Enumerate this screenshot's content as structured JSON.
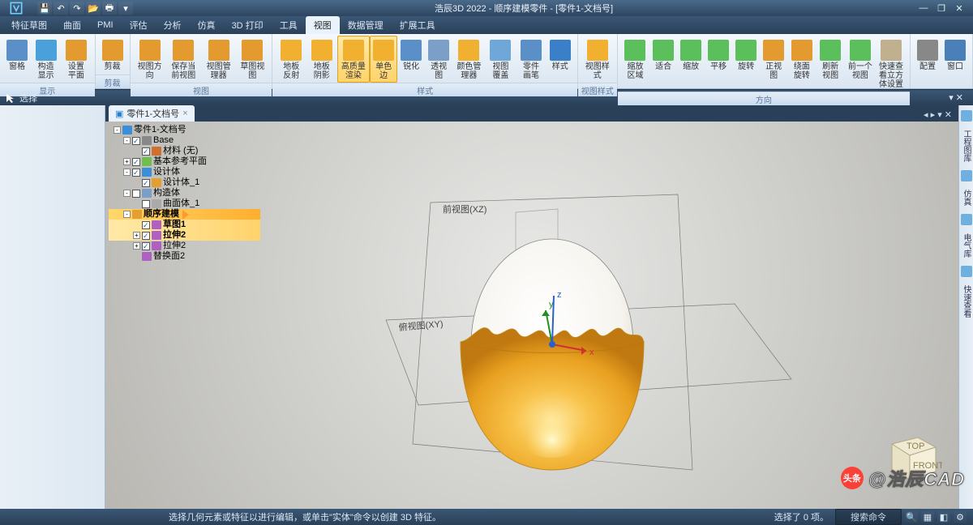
{
  "title": "浩辰3D 2022 - 顺序建模零件 - [零件1-文档号]",
  "qat_icons": [
    "save",
    "undo",
    "redo",
    "open",
    "print",
    "cut",
    "copy",
    "more"
  ],
  "menus": [
    "特征草图",
    "曲面",
    "PMI",
    "评估",
    "分析",
    "仿真",
    "3D 打印",
    "工具",
    "视图",
    "数据管理",
    "扩展工具"
  ],
  "active_menu": 8,
  "ribbon": {
    "groups": [
      {
        "label": "显示",
        "buttons": [
          {
            "label": "窗格",
            "icon": "#5b8fc7",
            "active": false
          },
          {
            "label": "构造显示",
            "icon": "#4aa0d8",
            "active": false
          },
          {
            "label": "设置平面",
            "icon": "#e39a2e",
            "active": false
          }
        ]
      },
      {
        "label": "剪裁",
        "buttons": [
          {
            "label": "剪裁",
            "icon": "#e39a2e",
            "active": false
          }
        ]
      },
      {
        "label": "视图",
        "buttons": [
          {
            "label": "视图方向",
            "icon": "#e39a2e",
            "active": false
          },
          {
            "label": "保存当前视图",
            "icon": "#e39a2e",
            "active": false
          },
          {
            "label": "视图管理器",
            "icon": "#e39a2e",
            "active": false
          },
          {
            "label": "草图视图",
            "icon": "#e39a2e",
            "active": false
          }
        ]
      },
      {
        "label": "样式",
        "buttons": [
          {
            "label": "地板反射",
            "icon": "#f2b030",
            "active": false
          },
          {
            "label": "地板阴影",
            "icon": "#f2b030",
            "active": false
          },
          {
            "label": "高质量渲染",
            "icon": "#f2b030",
            "active": true
          },
          {
            "label": "单色边",
            "icon": "#f2b030",
            "active": true
          },
          {
            "label": "锐化",
            "icon": "#5b8fc7",
            "active": false
          },
          {
            "label": "透视图",
            "icon": "#7b9fc7",
            "active": false
          },
          {
            "label": "颜色管理器",
            "icon": "#f2b030",
            "active": false
          },
          {
            "label": "视图覆盖",
            "icon": "#6fa8d8",
            "active": false
          },
          {
            "label": "零件画笔",
            "icon": "#5b8fc7",
            "active": false
          },
          {
            "label": "样式",
            "icon": "#3a7fc7",
            "active": false
          }
        ]
      },
      {
        "label": "视图样式",
        "buttons": [
          {
            "label": "视图样式",
            "icon": "#f2b030",
            "active": false
          }
        ]
      },
      {
        "label": "方向",
        "buttons": [
          {
            "label": "缩放区域",
            "icon": "#5bbf5b",
            "active": false
          },
          {
            "label": "适合",
            "icon": "#5bbf5b",
            "active": false
          },
          {
            "label": "缩放",
            "icon": "#5bbf5b",
            "active": false
          },
          {
            "label": "平移",
            "icon": "#5bbf5b",
            "active": false
          },
          {
            "label": "旋转",
            "icon": "#5bbf5b",
            "active": false
          },
          {
            "label": "正视图",
            "icon": "#e39a2e",
            "active": false
          },
          {
            "label": "绕面旋转",
            "icon": "#e39a2e",
            "active": false
          },
          {
            "label": "刷新视图",
            "icon": "#5bbf5b",
            "active": false
          },
          {
            "label": "前一个视图",
            "icon": "#5bbf5b",
            "active": false
          },
          {
            "label": "快速查看立方体设置",
            "icon": "#c0b090",
            "active": false
          }
        ]
      },
      {
        "label": "",
        "buttons": [
          {
            "label": "配置",
            "icon": "#888",
            "active": false
          },
          {
            "label": "窗口",
            "icon": "#4a7fb7",
            "active": false
          }
        ]
      }
    ]
  },
  "selection_bar": {
    "label": "选择"
  },
  "doc_tab": {
    "label": "零件1-文档号"
  },
  "tree": [
    {
      "ind": 0,
      "exp": "-",
      "chk": null,
      "ico": "#3a8fd8",
      "txt": "零件1-文档号",
      "hl": false
    },
    {
      "ind": 1,
      "exp": "-",
      "chk": true,
      "ico": "#888",
      "txt": "Base",
      "hl": false
    },
    {
      "ind": 2,
      "exp": null,
      "chk": true,
      "ico": "#d07030",
      "txt": "材料 (无)",
      "hl": false
    },
    {
      "ind": 1,
      "exp": "+",
      "chk": true,
      "ico": "#6fbf4f",
      "txt": "基本参考平面",
      "hl": false
    },
    {
      "ind": 1,
      "exp": "-",
      "chk": true,
      "ico": "#3a8fd8",
      "txt": "设计体",
      "hl": false
    },
    {
      "ind": 2,
      "exp": null,
      "chk": true,
      "ico": "#e3a030",
      "txt": "设计体_1",
      "hl": false
    },
    {
      "ind": 1,
      "exp": "-",
      "chk": false,
      "ico": "#7a9fc7",
      "txt": "构造体",
      "hl": false
    },
    {
      "ind": 2,
      "exp": null,
      "chk": false,
      "ico": "#aaa",
      "txt": "曲面体_1",
      "hl": false
    },
    {
      "ind": 1,
      "exp": "-",
      "chk": null,
      "ico": "#e3a030",
      "txt": "顺序建模",
      "hl": "main"
    },
    {
      "ind": 2,
      "exp": null,
      "chk": true,
      "ico": "#b060c0",
      "txt": "草图1",
      "hl": "sub"
    },
    {
      "ind": 2,
      "exp": "+",
      "chk": true,
      "ico": "#b060c0",
      "txt": "拉伸2",
      "hl": "sub"
    },
    {
      "ind": 2,
      "exp": "+",
      "chk": true,
      "ico": "#b060c0",
      "txt": "拉伸2",
      "hl": false
    },
    {
      "ind": 2,
      "exp": null,
      "chk": null,
      "ico": "#b060c0",
      "txt": "替换面2",
      "hl": false
    }
  ],
  "viewport": {
    "plane_label_front": "前视图(XZ)",
    "plane_label_top": "俯视图(XY)",
    "axes": {
      "x": "x",
      "y": "y",
      "z": "z"
    }
  },
  "right_dock": [
    {
      "icon": "#6fb0e0",
      "label": "工程图库"
    },
    {
      "icon": "#6fb0e0",
      "label": "仿真"
    },
    {
      "icon": "#6fb0e0",
      "label": "电气库"
    },
    {
      "icon": "#6fb0e0",
      "label": "快速查看"
    }
  ],
  "viewcube": {
    "top": "TOP",
    "front": "FRONT"
  },
  "statusbar": {
    "hint": "选择几何元素或特征以进行编辑，或单击\"实体\"命令以创建 3D 特征。",
    "selinfo": "选择了 0 项。",
    "search_placeholder": "搜索命令"
  },
  "watermark": {
    "logo": "头条",
    "text": "@浩辰CAD"
  }
}
